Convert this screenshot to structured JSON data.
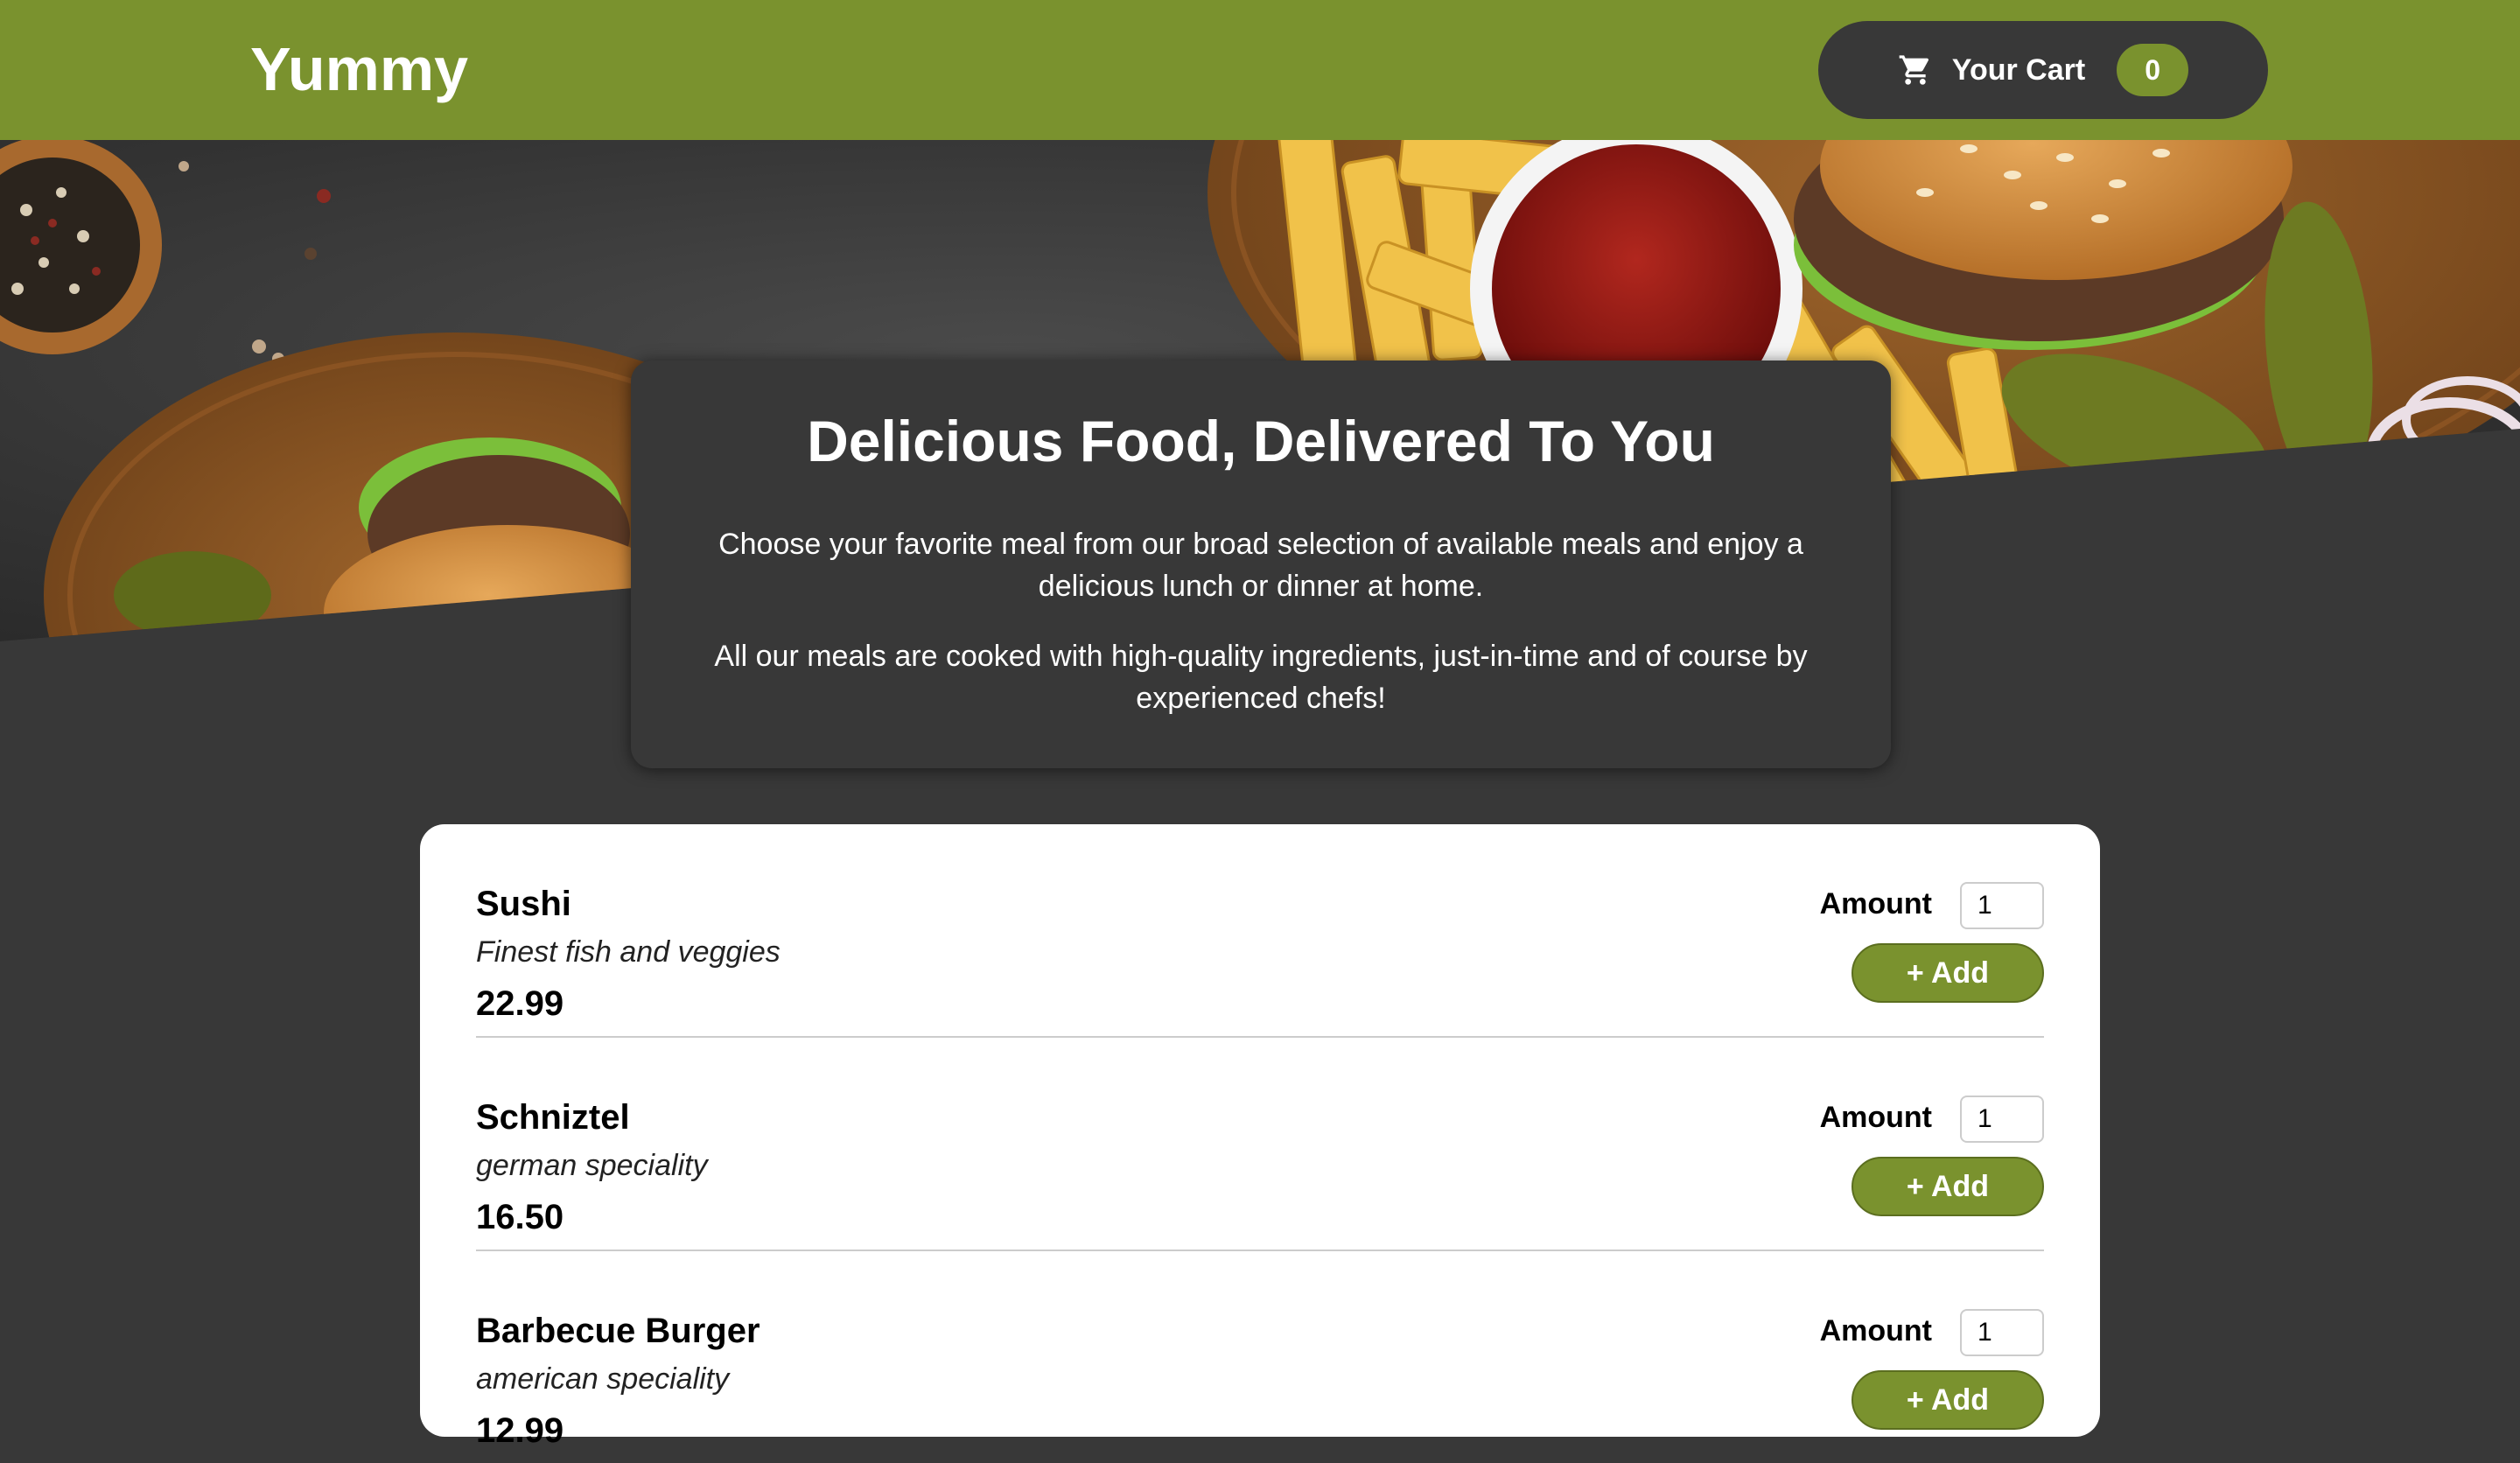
{
  "header": {
    "brand": "Yummy",
    "cart_label": "Your Cart",
    "cart_count": "0"
  },
  "intro": {
    "title": "Delicious Food, Delivered To You",
    "paragraph_1": "Choose your favorite meal from our broad selection of available meals and enjoy a delicious lunch or dinner at home.",
    "paragraph_2": "All our meals are cooked with high-quality ingredients, just-in-time and of course by experienced chefs!"
  },
  "meals": [
    {
      "name": "Sushi",
      "description": "Finest fish and veggies",
      "price": "22.99",
      "amount_label": "Amount",
      "amount_value": "1",
      "add_label": "+ Add"
    },
    {
      "name": "Schniztel",
      "description": "german speciality",
      "price": "16.50",
      "amount_label": "Amount",
      "amount_value": "1",
      "add_label": "+ Add"
    },
    {
      "name": "Barbecue Burger",
      "description": "american speciality",
      "price": "12.99",
      "amount_label": "Amount",
      "amount_value": "1",
      "add_label": "+ Add"
    }
  ],
  "colors": {
    "accent": "#7a922e",
    "background": "#383838",
    "card": "#ffffff"
  },
  "icons": {
    "cart": "cart-icon"
  }
}
